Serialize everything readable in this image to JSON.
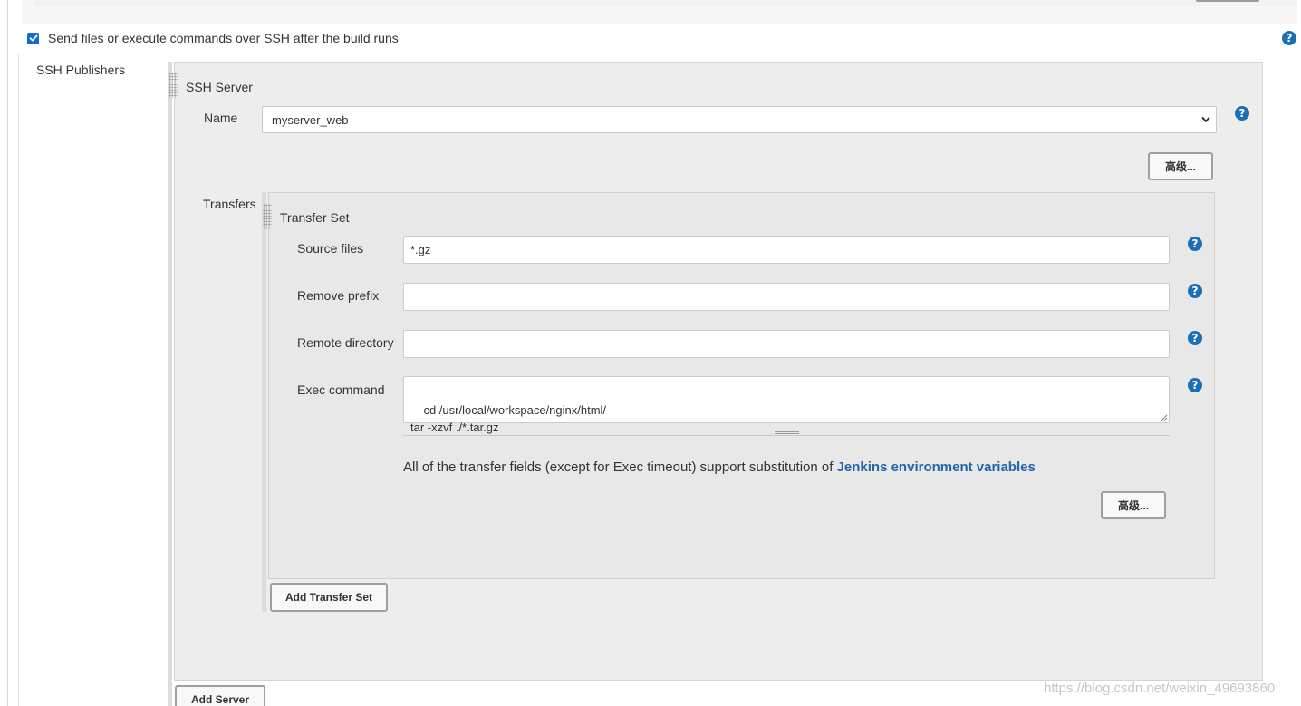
{
  "section": {
    "checkbox_label": "Send files or execute commands over SSH after the build runs",
    "checkbox_checked": true,
    "help_glyph": "?"
  },
  "publishers": {
    "label": "SSH Publishers",
    "server": {
      "title": "SSH Server",
      "name_label": "Name",
      "name_value": "myserver_web",
      "advanced_label": "高级...",
      "transfers_label": "Transfers",
      "transfer_set": {
        "title": "Transfer Set",
        "source_files_label": "Source files",
        "source_files_value": "*.gz",
        "remove_prefix_label": "Remove prefix",
        "remove_prefix_value": "",
        "remote_directory_label": "Remote directory",
        "remote_directory_value": "",
        "exec_command_label": "Exec command",
        "exec_command_value": "cd /usr/local/workspace/nginx/html/\ntar -xzvf ./*.tar.gz",
        "info_text": "All of the transfer fields (except for Exec timeout) support substitution of ",
        "info_link": "Jenkins environment variables",
        "advanced_label": "高级..."
      },
      "add_transfer_set_label": "Add Transfer Set"
    },
    "add_server_label": "Add Server"
  },
  "watermark": "https://blog.csdn.net/weixin_49693860",
  "colors": {
    "accent": "#1b6fb6",
    "link": "#2365a8",
    "checkbox": "#0f6ad6"
  }
}
